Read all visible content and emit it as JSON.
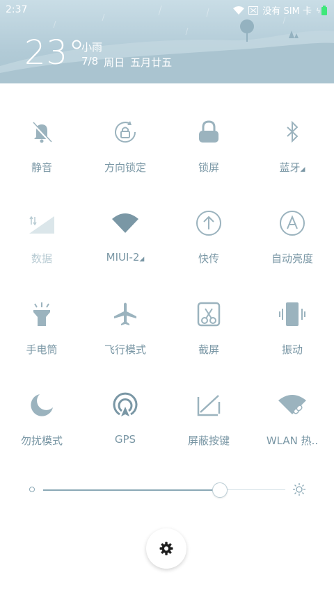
{
  "status_bar": {
    "time": "2:37",
    "carrier": "没有 SIM 卡"
  },
  "weather": {
    "temperature": "23°",
    "condition": "小雨",
    "date": "7/8",
    "weekday": "周日",
    "lunar": "五月廿五"
  },
  "toggles": [
    {
      "label": "静音",
      "icon": "bell-off-icon",
      "state": "on"
    },
    {
      "label": "方向锁定",
      "icon": "rotation-lock-icon",
      "state": "off"
    },
    {
      "label": "锁屏",
      "icon": "lock-icon",
      "state": "on"
    },
    {
      "label": "蓝牙",
      "icon": "bluetooth-icon",
      "state": "off"
    },
    {
      "label": "数据",
      "icon": "mobile-data-icon",
      "state": "disabled"
    },
    {
      "label": "MIUI-2",
      "icon": "wifi-icon",
      "state": "on"
    },
    {
      "label": "快传",
      "icon": "upload-icon",
      "state": "off"
    },
    {
      "label": "自动亮度",
      "icon": "auto-brightness-icon",
      "state": "off"
    },
    {
      "label": "手电筒",
      "icon": "flashlight-icon",
      "state": "on"
    },
    {
      "label": "飞行模式",
      "icon": "airplane-icon",
      "state": "on"
    },
    {
      "label": "截屏",
      "icon": "screenshot-icon",
      "state": "off"
    },
    {
      "label": "振动",
      "icon": "vibrate-icon",
      "state": "on"
    },
    {
      "label": "勿扰模式",
      "icon": "moon-icon",
      "state": "on"
    },
    {
      "label": "GPS",
      "icon": "gps-icon",
      "state": "on"
    },
    {
      "label": "屏蔽按键",
      "icon": "block-keys-icon",
      "state": "off"
    },
    {
      "label": "WLAN 热..",
      "icon": "hotspot-icon",
      "state": "on"
    }
  ],
  "brightness": {
    "level": 0.73
  },
  "colors": {
    "accent": "#7a97a5",
    "header": "#b2cbd7",
    "icon": "#9bb3be"
  }
}
